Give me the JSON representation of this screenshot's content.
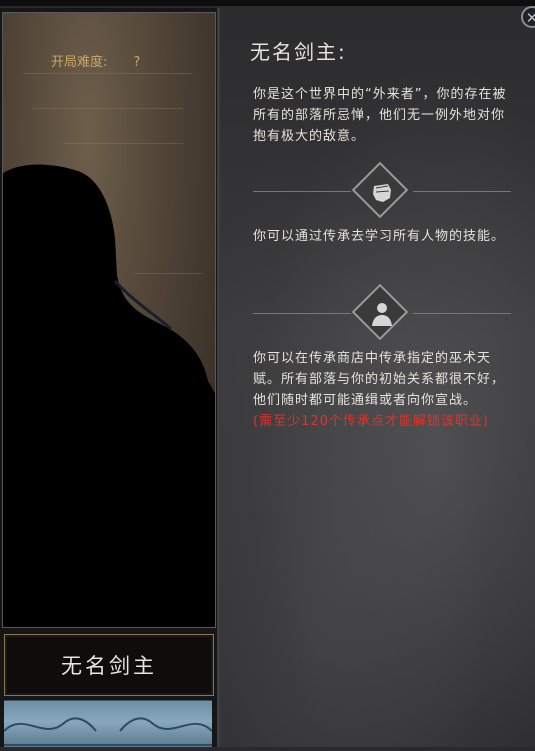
{
  "card": {
    "difficulty_label": "开局难度:",
    "difficulty_value": "?",
    "name": "无名剑主"
  },
  "detail": {
    "title": "无名剑主:",
    "intro": "你是这个世界中的“外来者”，你的存在被所有的部落所忌惮，他们无一例外地对你抱有极大的敌意。",
    "skill_text": "你可以通过传承去学习所有人物的技能。",
    "shop_text": "你可以在传承商店中传承指定的巫术天赋。所有部落与你的初始关系都很不好，他们随时都可能通缉或者向你宣战。",
    "unlock_requirement": "(需至少120个传承点才能解锁该职业)"
  },
  "icons": {
    "close": "close-icon",
    "skill": "fist-icon",
    "shop": "bust-icon"
  },
  "colors": {
    "accent_gold": "#c9a76a",
    "warning_red": "#e0322a"
  }
}
